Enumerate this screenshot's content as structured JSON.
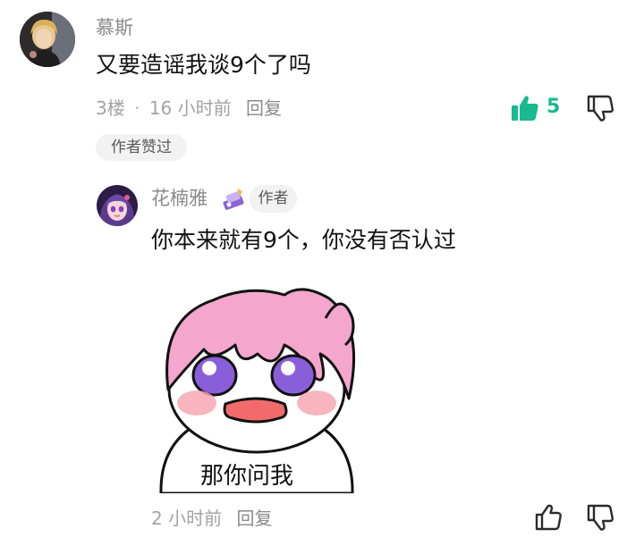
{
  "comment": {
    "author": "慕斯",
    "text": "又要造谣我谈9个了吗",
    "floor": "3楼",
    "separator": "·",
    "time": "16 小时前",
    "reply_label": "回复",
    "likes": "5",
    "liked": true,
    "author_liked_badge": "作者赞过"
  },
  "reply": {
    "author": "花楠雅",
    "author_badge": "作者",
    "text": "你本来就有9个，你没有否认过",
    "sticker_caption": "那你问我",
    "time": "2 小时前",
    "reply_label": "回复"
  },
  "colors": {
    "accent": "#1ab98f",
    "muted": "#a2a2a2",
    "chip_bg": "#f2f2f2"
  },
  "icons": {
    "like": "thumbs-up-icon",
    "dislike": "thumbs-down-icon",
    "badge": "medal-icon"
  }
}
